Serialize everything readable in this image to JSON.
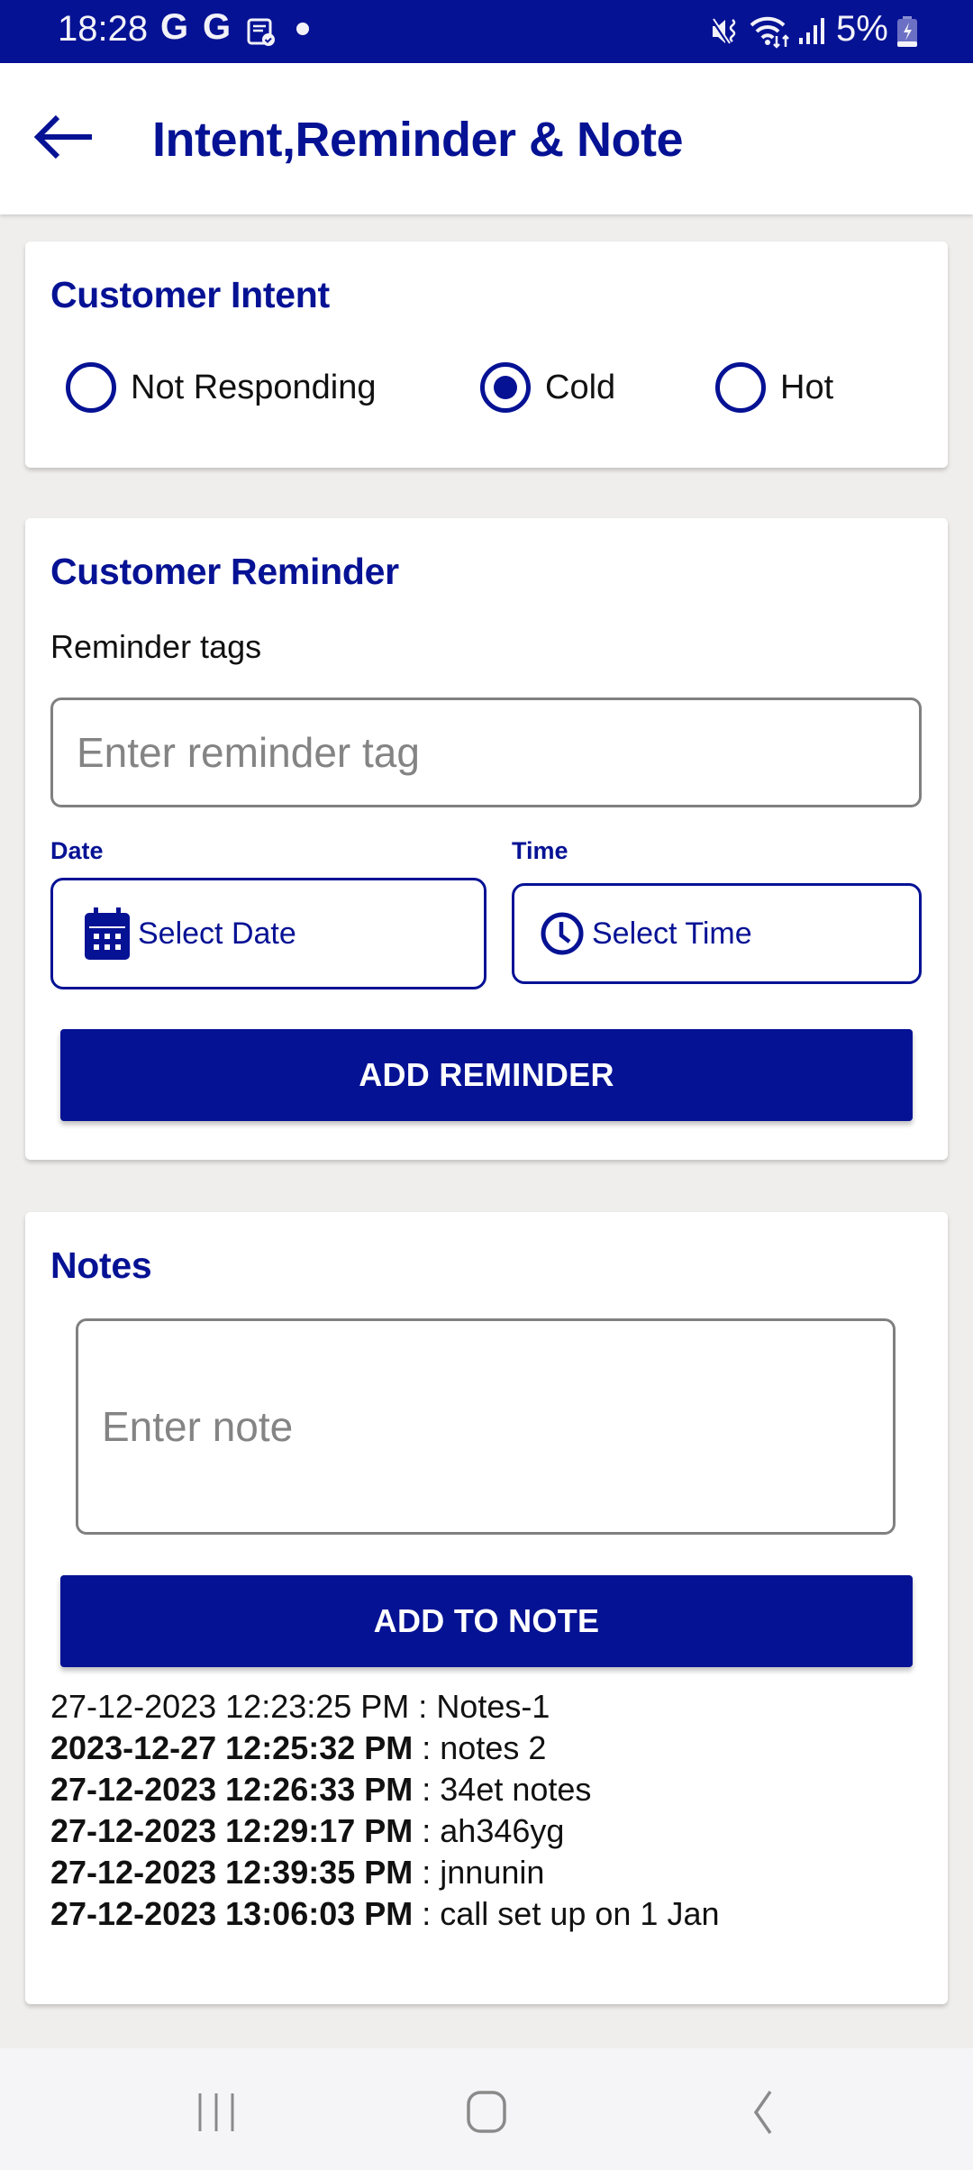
{
  "status_bar": {
    "time": "18:28",
    "notification_icons": [
      "google-icon",
      "google-icon",
      "task-check-icon",
      "dot-icon"
    ],
    "g1": "G",
    "g2": "G",
    "right_icons": [
      "mute-vibrate-icon",
      "wifi-icon",
      "signal-icon",
      "battery-charging-icon"
    ],
    "battery": "5%"
  },
  "app_bar": {
    "back_icon": "arrow-left-icon",
    "title": "Intent,Reminder & Note"
  },
  "intent": {
    "title": "Customer Intent",
    "options": [
      {
        "label": "Not Responding",
        "checked": false
      },
      {
        "label": "Cold",
        "checked": true
      },
      {
        "label": "Hot",
        "checked": false
      }
    ],
    "accent": "#061294"
  },
  "reminder": {
    "title": "Customer Reminder",
    "tags_label": "Reminder tags",
    "tag_placeholder": "Enter reminder tag",
    "tag_value": "",
    "date_label": "Date",
    "date_button": "Select Date",
    "date_icon": "calendar-icon",
    "time_label": "Time",
    "time_button": "Select Time",
    "time_icon": "clock-icon",
    "add_button": "ADD REMINDER"
  },
  "notes": {
    "title": "Notes",
    "note_placeholder": "Enter note",
    "note_value": "",
    "add_button": "ADD TO NOTE",
    "items": [
      {
        "timestamp": "27-12-2023 12:23:25 PM",
        "text": "Notes-1",
        "bold": false
      },
      {
        "timestamp": "2023-12-27 12:25:32 PM",
        "text": "notes 2",
        "bold": true
      },
      {
        "timestamp": "27-12-2023 12:26:33 PM",
        "text": "34et notes",
        "bold": true
      },
      {
        "timestamp": "27-12-2023 12:29:17 PM",
        "text": "ah346yg",
        "bold": true
      },
      {
        "timestamp": "27-12-2023 12:39:35 PM",
        "text": "jnnunin",
        "bold": true
      },
      {
        "timestamp": "27-12-2023 13:06:03 PM",
        "text": "call set up on 1 Jan",
        "bold": true
      }
    ],
    "separator": " : "
  },
  "nav_bar": {
    "buttons": [
      "recent-apps-icon",
      "home-icon",
      "back-icon"
    ]
  },
  "colors": {
    "primary": "#061294",
    "background": "#efeeec",
    "card": "#ffffff"
  }
}
